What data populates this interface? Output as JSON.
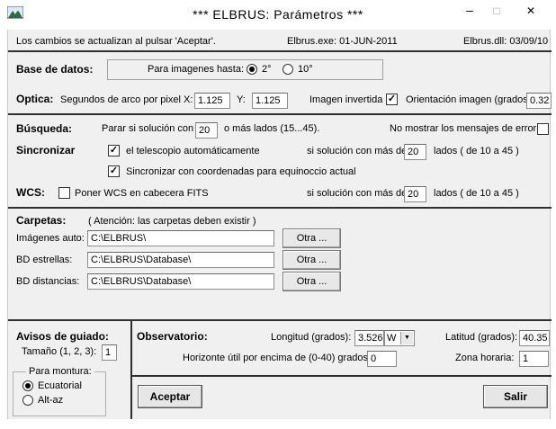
{
  "window": {
    "title": "***    ELBRUS:   Parámetros     ***",
    "minimize": "–",
    "maximize": "□",
    "close": "✕"
  },
  "info": {
    "notice": "Los cambios se actualizan al  pulsar 'Aceptar'.",
    "exe_version": "Elbrus.exe: 01-JUN-2011",
    "dll_version": "Elbrus.dll: 03/09/10"
  },
  "database": {
    "label": "Base de datos:",
    "images_up_to": "Para imagenes hasta:",
    "opt_2": "2°",
    "opt_10": "10°",
    "selected": "2°"
  },
  "optics": {
    "label": "Optica:",
    "arcsec_label": "Segundos de arco por pixel X:",
    "x_value": "1.125",
    "y_label": "Y:",
    "y_value": "1.125",
    "inverted_label": "Imagen invertida",
    "inverted_checked": true,
    "orientation_label": "Orientación imagen (grados):",
    "orientation_value": "0.32"
  },
  "search": {
    "label": "Búsqueda:",
    "stop_prefix": "Parar si solución con",
    "stop_value": "20",
    "stop_suffix": "o más lados (15...45).",
    "hide_errors_label": "No mostrar los mensajes de error",
    "hide_errors_checked": false
  },
  "sync": {
    "label": "Sincronizar",
    "auto_label": "el telescopio automáticamente",
    "auto_checked": true,
    "sides_prefix": "si solución con más de",
    "sides_value": "20",
    "sides_suffix": "lados ( de 10 a 45 )",
    "equinox_label": "Sincronizar con coordenadas para equinoccio actual",
    "equinox_checked": true
  },
  "wcs": {
    "label": "WCS:",
    "header_label": "Poner WCS en cabecera FITS",
    "header_checked": false,
    "sides_prefix": "si solución con más de",
    "sides_value": "20",
    "sides_suffix": "lados ( de 10 a 45 )"
  },
  "folders": {
    "label": "Carpetas:",
    "warning": "( Atención: las carpetas deben existir )",
    "rows": [
      {
        "label": "Imágenes auto:",
        "path": "C:\\ELBRUS\\",
        "button": "Otra ..."
      },
      {
        "label": "BD estrellas:",
        "path": "C:\\ELBRUS\\Database\\",
        "button": "Otra ..."
      },
      {
        "label": "BD distancias:",
        "path": "C:\\ELBRUS\\Database\\",
        "button": "Otra ..."
      }
    ]
  },
  "guiding": {
    "label": "Avisos de guiado:",
    "size_label": "Tamaño (1, 2, 3):",
    "size_value": "1",
    "mount_label": "Para montura:",
    "equatorial": "Ecuatorial",
    "altaz": "Alt-az",
    "selected": "Ecuatorial"
  },
  "observatory": {
    "label": "Observatorio:",
    "longitude_label": "Longitud (grados):",
    "longitude_value": "3.526",
    "longitude_dir": "W",
    "latitude_label": "Latitud (grados):",
    "latitude_value": "40.35",
    "horizon_label": "Horizonte útil por encima de (0-40) grados:",
    "horizon_value": "0",
    "timezone_label": "Zona horaria:",
    "timezone_value": "1"
  },
  "actions": {
    "accept": "Aceptar",
    "exit": "Salir"
  }
}
